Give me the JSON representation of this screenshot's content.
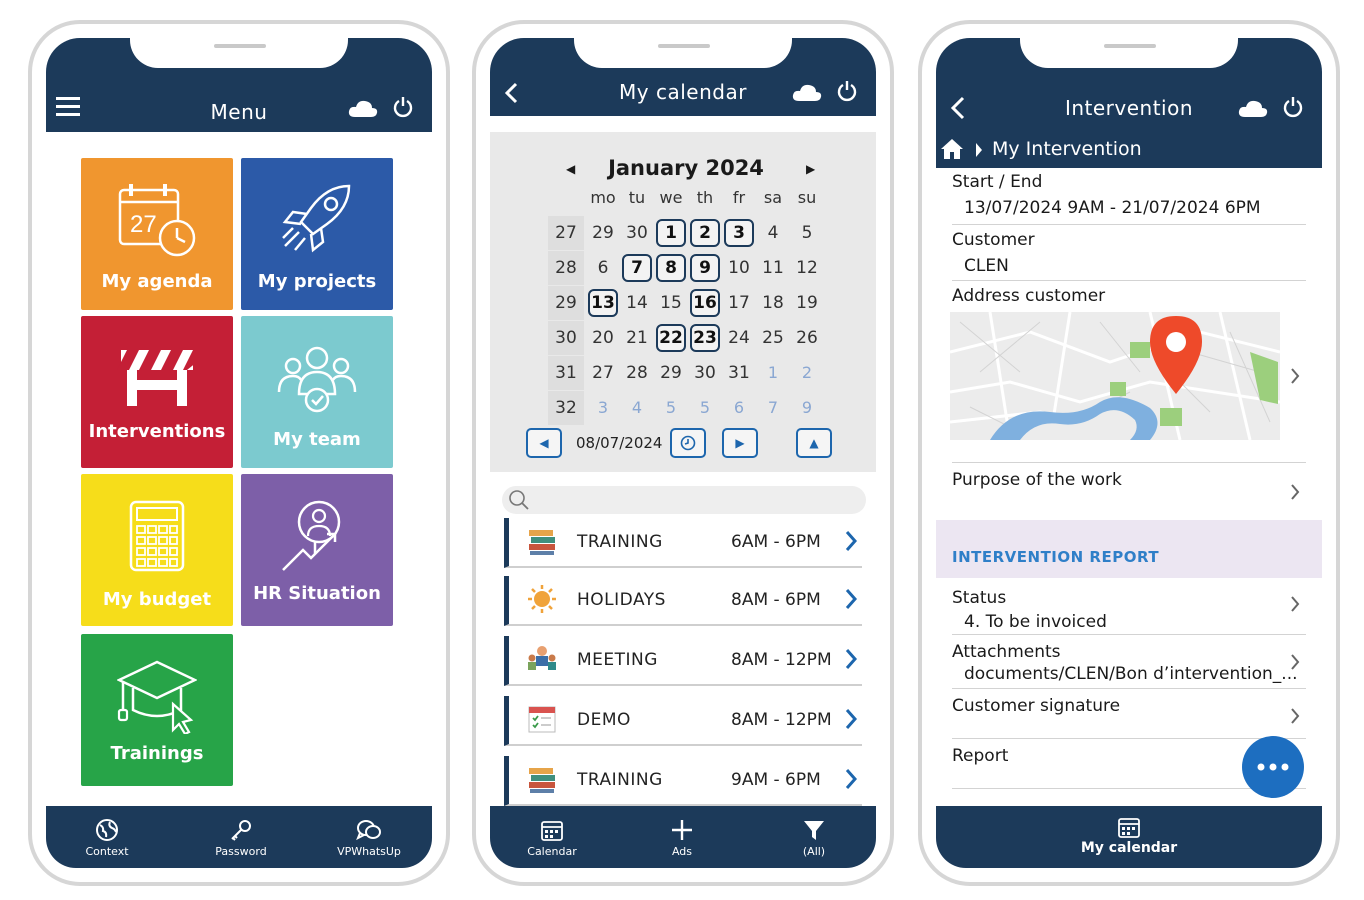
{
  "colors": {
    "navy": "#1c3a5a",
    "accent_blue": "#1d66ad",
    "report_bg": "#ece6f2"
  },
  "menu_phone": {
    "title": "Menu",
    "tiles": [
      {
        "label": "My agenda",
        "color": "#f0962f",
        "icon": "calendar-clock-icon",
        "calendar_digits": "27"
      },
      {
        "label": "My projects",
        "color": "#2c5aa8",
        "icon": "rocket-icon"
      },
      {
        "label": "Interventions",
        "color": "#c41f36",
        "icon": "barrier-icon"
      },
      {
        "label": "My team",
        "color": "#7ccacf",
        "icon": "team-icon"
      },
      {
        "label": "My budget",
        "color": "#f6dd1a",
        "icon": "calculator-icon"
      },
      {
        "label": "HR Situation",
        "color": "#7d5fa8",
        "icon": "hr-search-icon"
      },
      {
        "label": "Trainings",
        "color": "#27a448",
        "icon": "graduation-cap-icon"
      }
    ],
    "nav": [
      {
        "label": "Context",
        "icon": "globe-icon"
      },
      {
        "label": "Password",
        "icon": "key-icon"
      },
      {
        "label": "VPWhatsUp",
        "icon": "chat-icon"
      }
    ]
  },
  "calendar_phone": {
    "title": "My calendar",
    "month": "January 2024",
    "weekdays": [
      "mo",
      "tu",
      "we",
      "th",
      "fr",
      "sa",
      "su"
    ],
    "weeks": [
      {
        "num": "27",
        "days": [
          {
            "d": "29"
          },
          {
            "d": "30"
          },
          {
            "d": "1",
            "ev": true
          },
          {
            "d": "2",
            "ev": true
          },
          {
            "d": "3",
            "ev": true
          },
          {
            "d": "4"
          },
          {
            "d": "5"
          }
        ]
      },
      {
        "num": "28",
        "days": [
          {
            "d": "6"
          },
          {
            "d": "7",
            "ev": true
          },
          {
            "d": "8",
            "ev": true
          },
          {
            "d": "9",
            "ev": true
          },
          {
            "d": "10"
          },
          {
            "d": "11"
          },
          {
            "d": "12"
          }
        ]
      },
      {
        "num": "29",
        "days": [
          {
            "d": "13",
            "ev": true
          },
          {
            "d": "14"
          },
          {
            "d": "15"
          },
          {
            "d": "16",
            "ev": true
          },
          {
            "d": "17"
          },
          {
            "d": "18"
          },
          {
            "d": "19"
          }
        ]
      },
      {
        "num": "30",
        "days": [
          {
            "d": "20"
          },
          {
            "d": "21"
          },
          {
            "d": "22",
            "ev": true
          },
          {
            "d": "23",
            "ev": true
          },
          {
            "d": "24"
          },
          {
            "d": "25"
          },
          {
            "d": "26"
          }
        ]
      },
      {
        "num": "31",
        "days": [
          {
            "d": "27"
          },
          {
            "d": "28"
          },
          {
            "d": "29"
          },
          {
            "d": "30"
          },
          {
            "d": "31"
          },
          {
            "d": "1",
            "muted": true
          },
          {
            "d": "2",
            "muted": true
          }
        ]
      },
      {
        "num": "32",
        "days": [
          {
            "d": "3",
            "muted": true
          },
          {
            "d": "4",
            "muted": true
          },
          {
            "d": "5",
            "muted": true
          },
          {
            "d": "5",
            "muted": true
          },
          {
            "d": "6",
            "muted": true
          },
          {
            "d": "7",
            "muted": true
          },
          {
            "d": "9",
            "muted": true
          }
        ]
      }
    ],
    "selected_date": "08/07/2024",
    "events": [
      {
        "name": "TRAINING",
        "time": "6AM - 6PM",
        "icon": "books-icon"
      },
      {
        "name": "HOLIDAYS",
        "time": "8AM - 6PM",
        "icon": "sun-icon"
      },
      {
        "name": "MEETING",
        "time": "8AM - 12PM",
        "icon": "meeting-icon"
      },
      {
        "name": "DEMO",
        "time": "8AM - 12PM",
        "icon": "checklist-icon"
      },
      {
        "name": "TRAINING",
        "time": "9AM - 6PM",
        "icon": "books-icon"
      }
    ],
    "nav": [
      {
        "label": "Calendar",
        "icon": "calendar-icon"
      },
      {
        "label": "Ads",
        "icon": "plus-icon"
      },
      {
        "label": "(All)",
        "icon": "filter-icon"
      }
    ]
  },
  "intervention_phone": {
    "title": "Intervention",
    "breadcrumb": "My Intervention",
    "start_end_label": "Start / End",
    "start_end_value": "13/07/2024 9AM - 21/07/2024 6PM",
    "customer_label": "Customer",
    "customer_value": "CLEN",
    "address_label": "Address customer",
    "purpose_label": "Purpose of the work",
    "report_header": "INTERVENTION REPORT",
    "status_label": "Status",
    "status_value": "4. To be invoiced",
    "attachments_label": "Attachments",
    "attachments_value": "documents/CLEN/Bon d’intervention_...",
    "signature_label": "Customer signature",
    "report_label": "Report",
    "nav_label": "My calendar"
  }
}
